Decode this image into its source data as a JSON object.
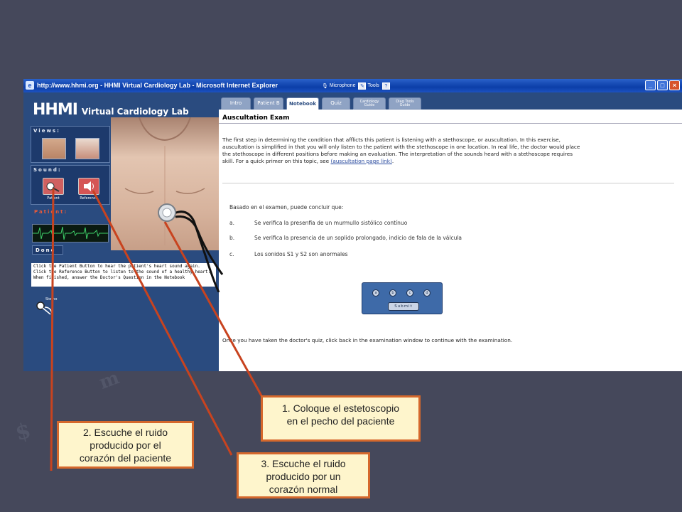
{
  "browser": {
    "title": "http://www.hhmi.org - HHMI Virtual Cardiology Lab - Microsoft Internet Explorer",
    "toolbar_microphone": "Microphone",
    "toolbar_tools": "Tools",
    "toolbar_help": "?",
    "win_minimize": "_",
    "win_maximize": "□",
    "win_close": "×"
  },
  "lab": {
    "logo_main": "HHMI",
    "logo_sub": "Virtual Cardiology Lab",
    "views_label": "Views:",
    "sound_label": "Sound:",
    "sound_patient": "Patient",
    "sound_reference": "Reference",
    "patient_label": "Patient:",
    "done_label": "Done",
    "instructions": [
      "Click the Patient Button to hear the patient's heart sound again.",
      "Click the Reference Button to listen to the sound of a healthy heart.",
      "When finished, answer the Doctor's Question in the Notebook"
    ],
    "stetho_label": "Stetho"
  },
  "tabs": [
    {
      "label": "Intro"
    },
    {
      "label": "Patient B"
    },
    {
      "label": "Notebook"
    },
    {
      "label": "Quiz"
    },
    {
      "label_1": "Cardiology",
      "label_2": "Guide"
    },
    {
      "label_1": "Diag Tools",
      "label_2": "Guide"
    }
  ],
  "notebook": {
    "title": "Auscultation Exam",
    "intro_lines": [
      "The first step in determining the condition that afflicts this patient is listening with a stethoscope, or auscultation. In this exercise,",
      "auscultation is simplified in that you will only listen to the patient with the stethoscope in one location. In real life, the doctor would place",
      "the stethoscope in different positions before making an evaluation. The interpretation of the sounds heard with a stethoscope requires"
    ],
    "intro_last": "skill. For a quick primer on this topic, see ",
    "intro_link": "(auscultation page link)",
    "intro_end": ".",
    "question": "Basado en el examen, puede concluir que:",
    "answers": [
      {
        "letter": "a.",
        "text": "Se verifica la presenfia de un murmullo sistólico contínuo"
      },
      {
        "letter": "b.",
        "text": "Se verifica la presencia de un soplido prolongado, indicio de fala de la válcula"
      },
      {
        "letter": "c.",
        "text": "Los sonidos S1 y S2 son anormales"
      }
    ],
    "radio_options": [
      "a",
      "b",
      "c",
      "d"
    ],
    "submit": "Submit",
    "footer": "Once you have taken the doctor's quiz, click back in the examination window to continue with the examination."
  },
  "callouts": {
    "c1_line1": "1.  Coloque el estetoscopio",
    "c1_line2": "en el pecho del paciente",
    "c2_line1": "2.  Escuche  el ruido",
    "c2_line2": "producido por el",
    "c2_line3": "corazón del paciente",
    "c3_line1": "3.  Escuche  el ruido",
    "c3_line2": "producido por un",
    "c3_line3": "corazón normal"
  },
  "colors": {
    "slide_bg": "#45485b",
    "panel_navy": "#2a4b7f",
    "callout_fill": "#fef5cc",
    "callout_border": "#d5682c",
    "arrow": "#c8431f"
  }
}
